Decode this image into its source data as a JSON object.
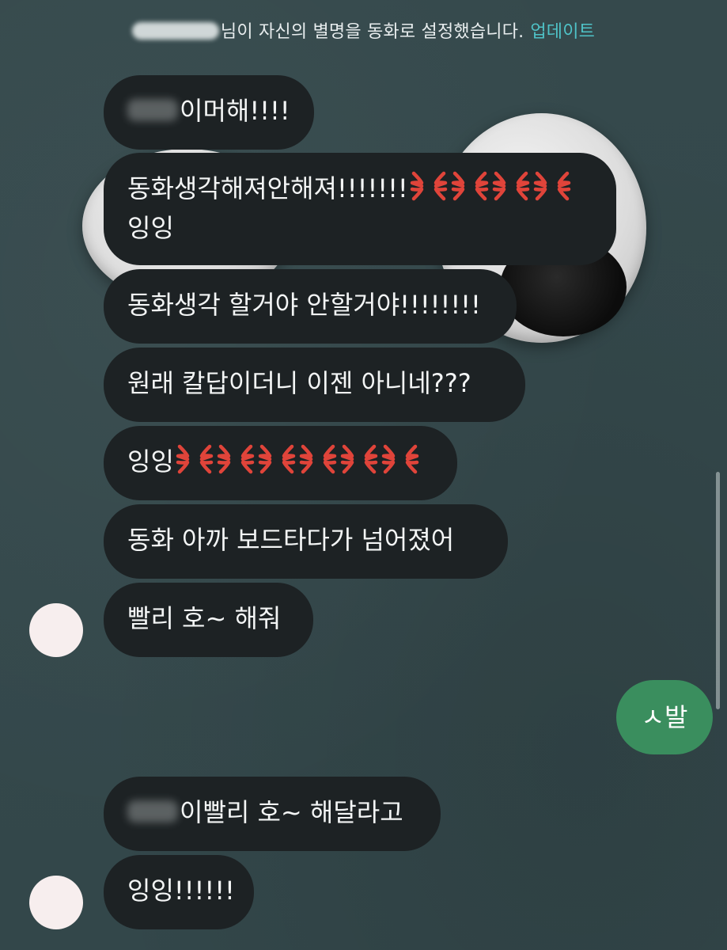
{
  "notice": {
    "text": "님이 자신의 별명을 동화로 설정했습니다.",
    "action": "업데이트"
  },
  "messages": [
    {
      "text": "이머해!!!!"
    },
    {
      "line1": "동화생각해져안해져!!!!!!!",
      "line2": "잉잉",
      "emoji": "anger-symbol-icon",
      "emoji_count": 4
    },
    {
      "text": "동화생각 할거야 안할거야!!!!!!!!"
    },
    {
      "text": "원래 칼답이더니 이젠 아니네???"
    },
    {
      "text": "잉잉",
      "emoji": "anger-symbol-icon",
      "emoji_count": 6
    },
    {
      "text": "동화 아까 보드타다가 넘어졌어"
    },
    {
      "text": "빨리 호~ 해줘"
    },
    {
      "text": "이빨리 호~ 해달라고"
    },
    {
      "text": "잉잉!!!!!!"
    }
  ],
  "my_message": {
    "text": "ㅅ발"
  },
  "colors": {
    "background": "#34484b",
    "incoming_bubble": "#1d2224",
    "outgoing_bubble": "#3a8e5e",
    "accent": "#4fc3c8",
    "anger_emoji": "#e0443a"
  }
}
